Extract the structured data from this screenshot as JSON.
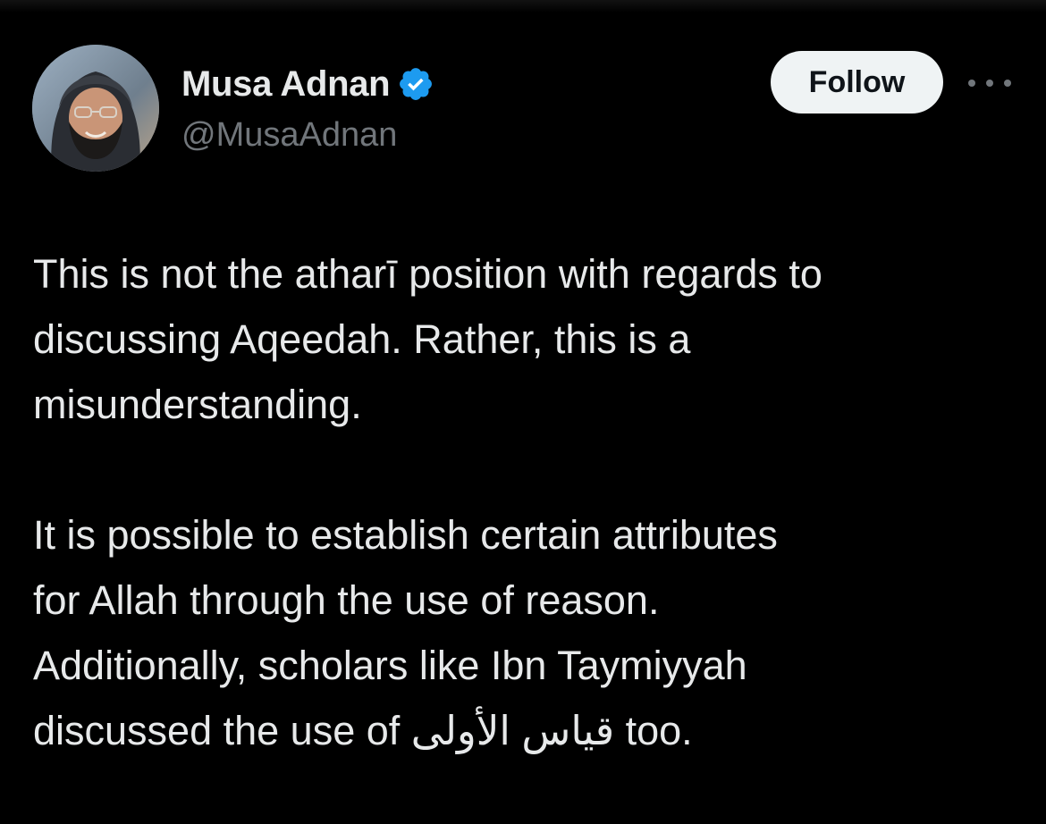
{
  "author": {
    "display_name": "Musa Adnan",
    "handle": "@MusaAdnan",
    "verified": true,
    "avatar": "profile-photo"
  },
  "actions": {
    "follow_label": "Follow",
    "more_icon": "more-horizontal-icon"
  },
  "tweet": {
    "paragraph_1": "This is not the atharī position with regards to\ndiscussing Aqeedah. Rather, this is a\nmisunderstanding.",
    "paragraph_2_lead": "It is possible to establish certain attributes\nfor Allah through the use of reason.\nAdditionally, scholars like Ibn Taymiyyah\ndiscussed the use of ",
    "paragraph_2_arabic": "قياس الأولى",
    "paragraph_2_tail": " too."
  },
  "colors": {
    "background": "#000000",
    "primary_text": "#e7e9ea",
    "secondary_text": "#71767b",
    "verified_blue": "#1d9bf0",
    "follow_bg": "#eff3f4"
  }
}
